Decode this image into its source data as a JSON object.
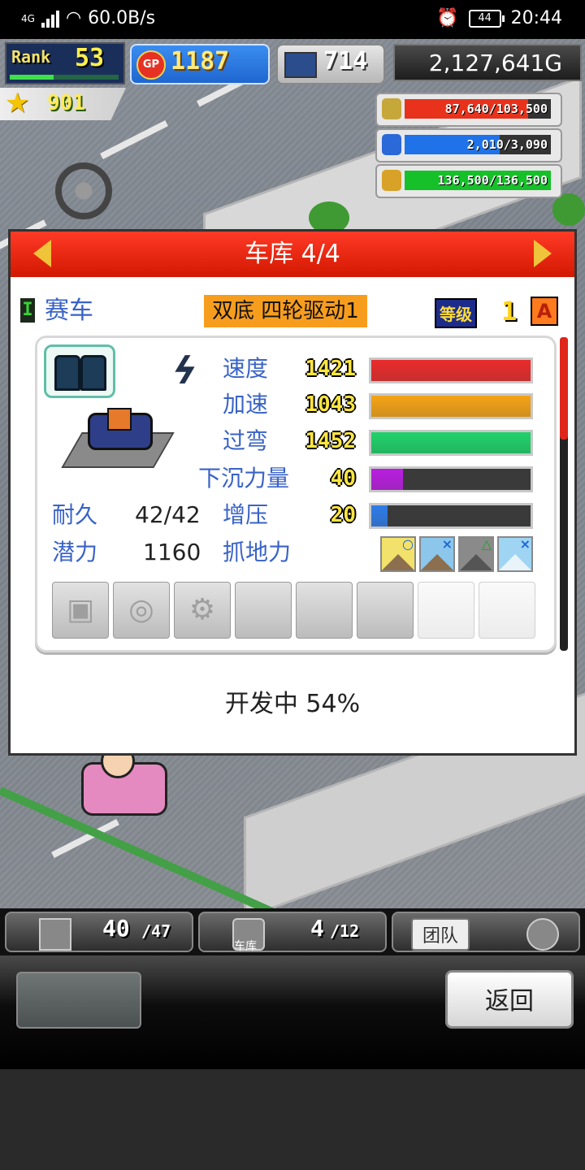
{
  "status_bar": {
    "network": "4G",
    "speed": "60.0B/s",
    "battery": "44",
    "time": "20:44"
  },
  "hud": {
    "rank_label": "Rank",
    "rank": "53",
    "gp": "1187",
    "gp_coin": "GP",
    "research": "714",
    "money": "2,127,641G",
    "fans": "901",
    "resources": [
      {
        "icon": "coin-stack-icon",
        "text": "87,640/103,500",
        "fraction": 0.847,
        "color": "#e8321c"
      },
      {
        "icon": "fuel-bottle-icon",
        "text": "2,010/3,090",
        "fraction": 0.65,
        "color": "#1f72e8"
      },
      {
        "icon": "wheat-icon",
        "text": "136,500/136,500",
        "fraction": 1.0,
        "color": "#15c028"
      }
    ]
  },
  "dialog": {
    "title": "车库 4/4",
    "car_type_icon": "I",
    "car_type": "赛车",
    "car_name": "双底 四轮驱动1",
    "grade_label": "等级",
    "grade": "1",
    "rank_badge": "A",
    "stats": [
      {
        "label": "速度",
        "value": "1421",
        "fraction": 1.0,
        "color": "#ea2b2b"
      },
      {
        "label": "加速",
        "value": "1043",
        "fraction": 1.0,
        "color": "#f5a416"
      },
      {
        "label": "过弯",
        "value": "1452",
        "fraction": 1.0,
        "color": "#1fd36a"
      },
      {
        "label": "下沉力量",
        "value": "40",
        "fraction": 0.2,
        "color": "#b91ee0"
      },
      {
        "label": "增压",
        "value": "20",
        "fraction": 0.1,
        "color": "#2f7ce8"
      }
    ],
    "durability_label": "耐久",
    "durability": "42/42",
    "potential_label": "潜力",
    "potential": "1160",
    "grip_label": "抓地力",
    "grip_icons": [
      {
        "name": "grip-sunny-icon",
        "mark": "○",
        "sky": "#f2e16a"
      },
      {
        "name": "grip-dirt-icon",
        "mark": "×",
        "sky": "#8cc6ea"
      },
      {
        "name": "grip-rain-icon",
        "mark": "△",
        "sky": "#8a8a8a"
      },
      {
        "name": "grip-snow-icon",
        "mark": "×",
        "sky": "#9fd4f2"
      }
    ],
    "part_slots": [
      "engine-part-icon",
      "tire-part-icon",
      "gear-part-icon",
      "",
      "",
      "",
      "",
      ""
    ],
    "dev_status": "开发中 54%"
  },
  "bottom": {
    "tab1_value": "40",
    "tab1_max": "/47",
    "tab2_value": "4",
    "tab2_max": "/12",
    "tab2_small": "车库",
    "team_label": "团队",
    "back_button": "返回"
  }
}
